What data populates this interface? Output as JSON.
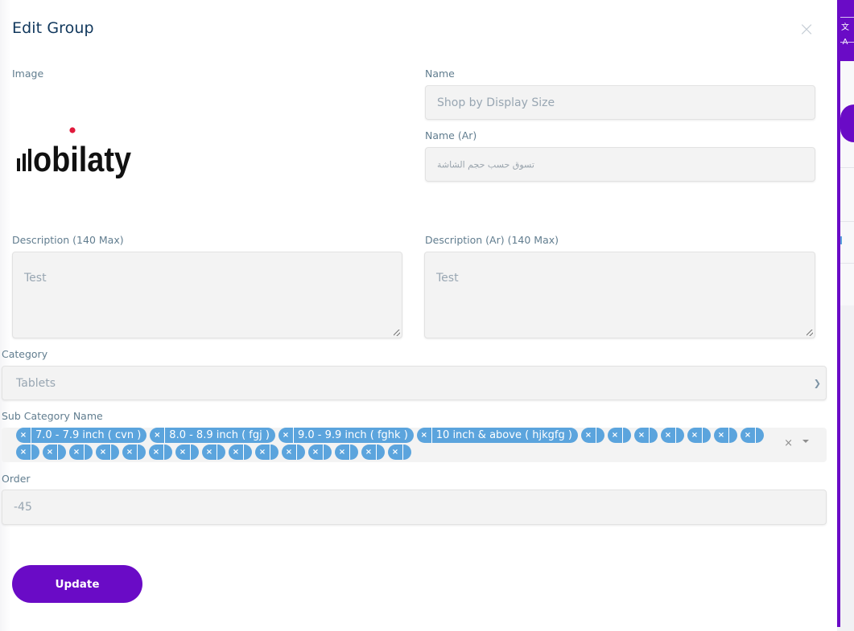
{
  "modal": {
    "title": "Edit Group",
    "close_icon": "close-icon"
  },
  "image": {
    "label": "Image",
    "logo_text": "obilaty",
    "logo_dot_color": "#e01a3c"
  },
  "name": {
    "label": "Name",
    "value": "Shop by Display Size"
  },
  "name_ar": {
    "label": "Name (Ar)",
    "value": "تسوق حسب حجم الشاشة"
  },
  "description": {
    "label": "Description (140 Max)",
    "value": "Test"
  },
  "description_ar": {
    "label": "Description (Ar) (140 Max)",
    "value": "Test"
  },
  "category": {
    "label": "Category",
    "selected": "Tablets"
  },
  "sub_category": {
    "label": "Sub Category Name",
    "chips": [
      "7.0 - 7.9 inch ( cvn )",
      "8.0 - 8.9 inch ( fgj )",
      "9.0 - 9.9 inch ( fghk )",
      "10 inch & above ( hjkgfg )",
      "",
      "",
      "",
      "",
      "",
      "",
      "",
      "",
      "",
      "",
      "",
      "",
      "",
      "",
      "",
      "",
      "",
      "",
      "",
      "",
      "",
      ""
    ],
    "chip_remove_glyph": "×",
    "clear_glyph": "×"
  },
  "order": {
    "label": "Order",
    "value": "-45"
  },
  "actions": {
    "update_label": "Update"
  },
  "colors": {
    "accent": "#6a0bc6",
    "chip": "#5ba4dd",
    "title": "#10375c",
    "label": "#617d8f"
  },
  "backdrop": {
    "translate_glyph": "文A"
  }
}
